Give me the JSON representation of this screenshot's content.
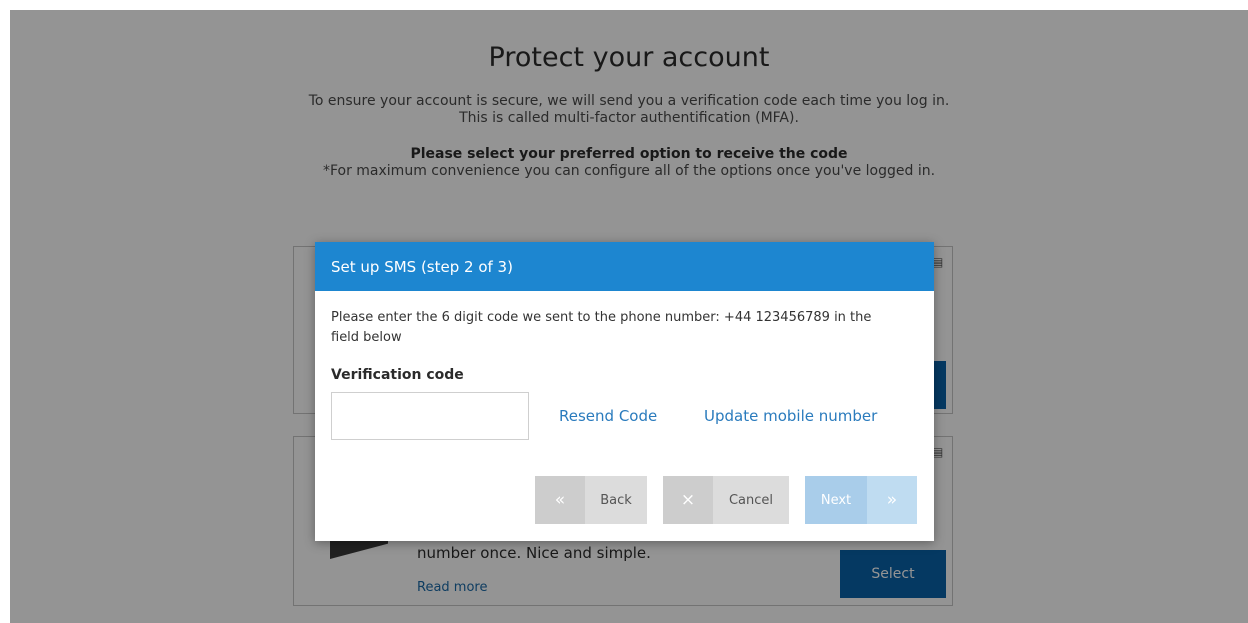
{
  "page": {
    "title": "Protect your account",
    "intro_line1": "To ensure your account is secure, we will send you a verification code each time you log in.",
    "intro_line2": "This is called multi-factor authentification (MFA).",
    "select_prompt": "Please select your preferred option to receive the code",
    "convenience_note": "*For maximum convenience you can configure all of the options once you've logged in."
  },
  "cards": {
    "sms_card_text": "number once. Nice and simple.",
    "read_more": "Read more",
    "select_label": "Select"
  },
  "modal": {
    "title": "Set up SMS (step 2 of 3)",
    "message": "Please enter the 6 digit code we sent to the phone number: +44 123456789 in the field below",
    "field_label": "Verification code",
    "code_value": "",
    "resend_label": "Resend Code",
    "update_label": "Update mobile number",
    "back_label": "Back",
    "cancel_label": "Cancel",
    "next_label": "Next"
  },
  "colors": {
    "header": "#1d86d0",
    "link": "#2a7bbd",
    "primary_button": "#0a62a9"
  }
}
